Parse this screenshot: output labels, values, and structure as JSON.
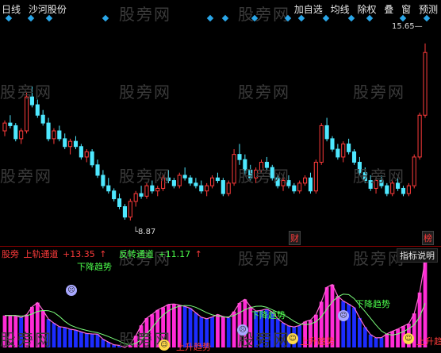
{
  "toolbar": {
    "period": "日线",
    "stock_name": "沙河股份",
    "buttons": [
      "加自选",
      "均线",
      "除权",
      "叠",
      "窗",
      "预测"
    ]
  },
  "watermark": "股旁网",
  "price_labels": {
    "high": "15.65",
    "low": "8.87"
  },
  "badges": {
    "fin": "财",
    "rank": "榜"
  },
  "indicator": {
    "name": "股旁",
    "series_a_label": "上轨通道",
    "series_a_value": "+13.35",
    "series_b_label": "反转通道",
    "series_b_value": "+11.17",
    "explain_button": "指标说明",
    "down_trend": "下降趋势",
    "up_trend": "上升趋势"
  },
  "colors": {
    "up": "#ff3b3b",
    "down": "#4ee8ff",
    "magenta": "#ff2bd6",
    "blue": "#1c2cff",
    "divider": "#8b0000"
  },
  "chart_data": {
    "type": "candlestick",
    "yrange": [
      8.2,
      16.4
    ],
    "high_label": 15.65,
    "low_label": 8.87,
    "candles": [
      [
        12.3,
        12.7,
        12.1,
        12.6
      ],
      [
        12.6,
        12.9,
        12.4,
        12.5
      ],
      [
        12.5,
        12.6,
        11.9,
        12.0
      ],
      [
        12.0,
        12.4,
        11.8,
        12.3
      ],
      [
        12.3,
        13.8,
        12.2,
        13.6
      ],
      [
        13.6,
        14.0,
        13.2,
        13.3
      ],
      [
        13.3,
        13.5,
        12.8,
        12.9
      ],
      [
        12.9,
        13.1,
        12.5,
        12.6
      ],
      [
        12.6,
        12.8,
        11.9,
        12.0
      ],
      [
        12.0,
        12.4,
        11.8,
        12.3
      ],
      [
        12.3,
        12.5,
        11.9,
        12.0
      ],
      [
        12.0,
        12.2,
        11.6,
        11.7
      ],
      [
        11.7,
        12.0,
        11.4,
        11.9
      ],
      [
        11.9,
        12.1,
        11.6,
        11.7
      ],
      [
        11.7,
        11.8,
        11.2,
        11.3
      ],
      [
        11.3,
        11.6,
        11.1,
        11.5
      ],
      [
        11.5,
        11.6,
        10.9,
        11.0
      ],
      [
        11.0,
        11.2,
        10.5,
        10.6
      ],
      [
        10.6,
        10.8,
        10.1,
        10.2
      ],
      [
        10.2,
        10.5,
        9.9,
        10.0
      ],
      [
        10.0,
        10.1,
        9.6,
        9.7
      ],
      [
        9.7,
        9.9,
        9.3,
        9.4
      ],
      [
        9.4,
        9.5,
        8.9,
        9.0
      ],
      [
        9.0,
        9.7,
        8.87,
        9.6
      ],
      [
        9.6,
        10.0,
        9.4,
        9.9
      ],
      [
        9.9,
        10.2,
        9.7,
        9.8
      ],
      [
        9.8,
        10.3,
        9.7,
        10.2
      ],
      [
        10.2,
        10.4,
        9.9,
        10.0
      ],
      [
        10.0,
        10.2,
        9.8,
        10.1
      ],
      [
        10.1,
        10.6,
        10.0,
        10.5
      ],
      [
        10.5,
        10.8,
        10.3,
        10.4
      ],
      [
        10.4,
        10.5,
        10.1,
        10.2
      ],
      [
        10.2,
        10.7,
        10.1,
        10.6
      ],
      [
        10.6,
        10.9,
        10.4,
        10.5
      ],
      [
        10.5,
        10.6,
        10.2,
        10.3
      ],
      [
        10.3,
        10.5,
        10.1,
        10.2
      ],
      [
        10.2,
        10.4,
        9.9,
        10.0
      ],
      [
        10.0,
        10.3,
        9.8,
        10.2
      ],
      [
        10.2,
        10.6,
        10.1,
        10.5
      ],
      [
        10.5,
        10.7,
        10.3,
        10.4
      ],
      [
        10.4,
        10.5,
        9.8,
        9.9
      ],
      [
        9.9,
        10.4,
        9.8,
        10.3
      ],
      [
        10.3,
        11.6,
        10.2,
        11.4
      ],
      [
        11.4,
        11.8,
        11.0,
        11.2
      ],
      [
        11.2,
        11.4,
        10.6,
        10.8
      ],
      [
        10.8,
        11.0,
        10.4,
        10.5
      ],
      [
        10.5,
        10.9,
        10.3,
        10.8
      ],
      [
        10.8,
        11.2,
        10.7,
        11.1
      ],
      [
        11.1,
        11.3,
        10.8,
        10.9
      ],
      [
        10.9,
        11.0,
        10.4,
        10.5
      ],
      [
        10.5,
        10.6,
        10.1,
        10.2
      ],
      [
        10.2,
        10.5,
        10.0,
        10.4
      ],
      [
        10.4,
        10.6,
        10.1,
        10.2
      ],
      [
        10.2,
        10.3,
        9.9,
        10.0
      ],
      [
        10.0,
        10.4,
        9.9,
        10.3
      ],
      [
        10.3,
        10.6,
        10.2,
        10.5
      ],
      [
        10.5,
        10.7,
        9.9,
        10.0
      ],
      [
        10.0,
        11.2,
        9.9,
        11.1
      ],
      [
        11.1,
        12.6,
        11.0,
        12.5
      ],
      [
        12.5,
        12.8,
        11.9,
        12.0
      ],
      [
        12.0,
        12.1,
        11.5,
        11.6
      ],
      [
        11.6,
        11.8,
        11.2,
        11.3
      ],
      [
        11.3,
        11.9,
        11.1,
        11.8
      ],
      [
        11.8,
        12.0,
        11.4,
        11.5
      ],
      [
        11.5,
        11.6,
        11.0,
        11.1
      ],
      [
        11.1,
        11.3,
        10.6,
        10.7
      ],
      [
        10.7,
        10.9,
        10.3,
        10.4
      ],
      [
        10.4,
        10.6,
        10.0,
        10.1
      ],
      [
        10.1,
        10.5,
        9.9,
        10.4
      ],
      [
        10.4,
        10.6,
        10.1,
        10.2
      ],
      [
        10.2,
        10.3,
        9.8,
        9.9
      ],
      [
        9.9,
        10.4,
        9.8,
        10.3
      ],
      [
        10.3,
        10.5,
        10.0,
        10.1
      ],
      [
        10.1,
        10.2,
        9.8,
        9.9
      ],
      [
        9.9,
        10.3,
        9.8,
        10.2
      ],
      [
        10.2,
        11.4,
        10.1,
        11.3
      ],
      [
        11.3,
        13.0,
        11.2,
        12.9
      ],
      [
        12.9,
        15.65,
        12.8,
        15.3
      ]
    ]
  }
}
